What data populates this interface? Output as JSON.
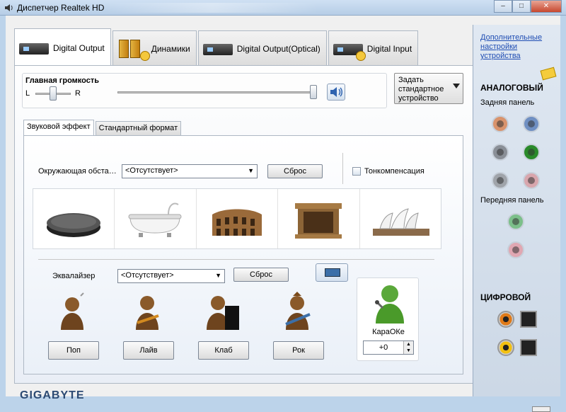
{
  "window": {
    "title": "Диспетчер Realtek HD"
  },
  "tabs": [
    {
      "label": "Digital Output",
      "icon": "device-icon",
      "active": true
    },
    {
      "label": "Динамики",
      "icon": "speakers-icon",
      "active": false
    },
    {
      "label": "Digital Output(Optical)",
      "icon": "device-icon",
      "active": false
    },
    {
      "label": "Digital Input",
      "icon": "device-input-icon",
      "active": false
    }
  ],
  "volume": {
    "label": "Главная громкость",
    "left": "L",
    "right": "R",
    "balance_level": 0.5,
    "level": 1.0
  },
  "set_default": {
    "label": "Задать стандартное устройство"
  },
  "subtabs": [
    {
      "label": "Звуковой эффект",
      "active": true
    },
    {
      "label": "Стандартный формат",
      "active": false
    }
  ],
  "effects": {
    "environment_label": "Окружающая обста…",
    "environment_value": "<Отсутствует>",
    "reset_label": "Сброс",
    "loudness_label": "Тонкомпенсация",
    "loudness_checked": false,
    "environments": [
      "pad-icon",
      "bathtub-icon",
      "colosseum-icon",
      "stone-room-icon",
      "opera-house-icon"
    ]
  },
  "equalizer": {
    "label": "Эквалайзер",
    "value": "<Отсутствует>",
    "reset_label": "Сброс",
    "presets": [
      "Поп",
      "Лайв",
      "Клаб",
      "Рок"
    ]
  },
  "karaoke": {
    "label": "КараОКе",
    "value": "+0"
  },
  "sidebar": {
    "advanced_link": "Дополнительные настройки устройства",
    "analog_title": "АНАЛОГОВЫЙ",
    "rear_panel": "Задняя панель",
    "front_panel": "Передняя панель",
    "digital_title": "ЦИФРОВОЙ",
    "rear_jacks": [
      "#d9936c",
      "#6f8fc2",
      "#8a8f97",
      "#2a8a2a",
      "#a0a4aa",
      "#d8a6ad"
    ],
    "front_jacks": [
      "#7cbf8a",
      "#e0a7b2"
    ]
  },
  "brand": "GIGABYTE"
}
